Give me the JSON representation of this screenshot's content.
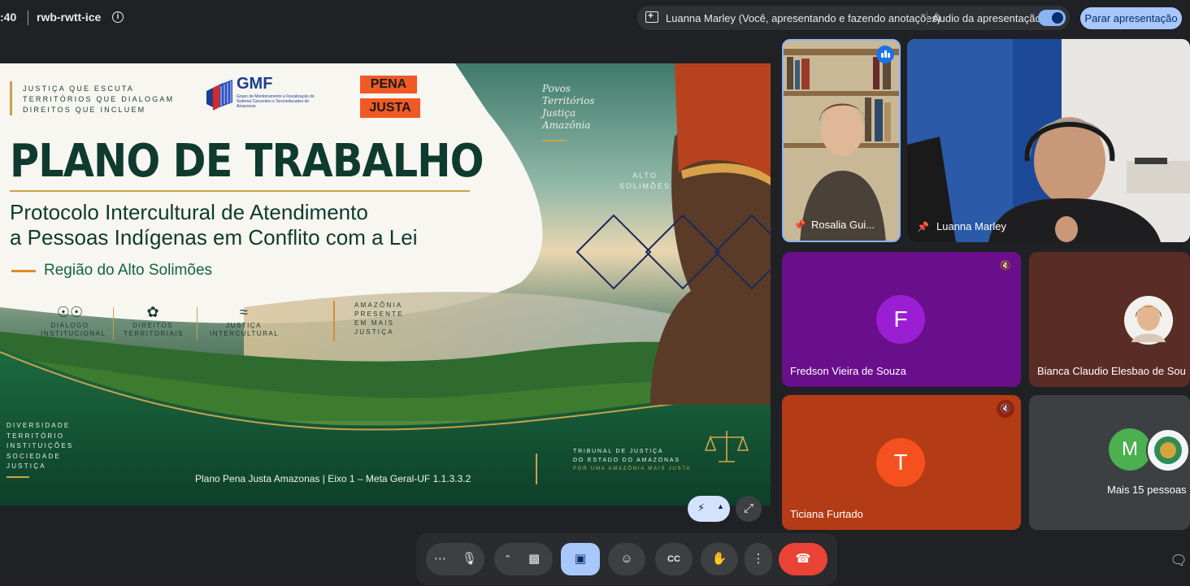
{
  "topbar": {
    "time": ":40",
    "meeting_code": "rwb-rwtt-ice",
    "presenter_text": "Luanna Marley (Você, apresentando e fazendo anotações)",
    "audio_label": "Áudio da apresentação",
    "stop_button": "Parar apresentação"
  },
  "slide": {
    "tagline": [
      "JUSTIÇA QUE ESCUTA",
      "TERRITÓRIOS QUE DIALOGAM",
      "DIREITOS QUE INCLUEM"
    ],
    "gmf": "GMF",
    "gmf_sub": "Grupo de Monitoramento e Fiscalização do Sistema Carcerário e Socioeducativo do Amazonas",
    "pena": "PENA",
    "justa": "JUSTA",
    "title": "PLANO DE TRABALHO",
    "subtitle_line1": "Protocolo Intercultural de Atendimento",
    "subtitle_line2": "a Pessoas Indígenas em Conflito com a Lei",
    "region": "Região do Alto Solimões",
    "pillars": [
      {
        "line1": "DIÁLOGO",
        "line2": "INSTITUCIONAL"
      },
      {
        "line1": "DIREITOS",
        "line2": "TERRITORIAIS"
      },
      {
        "line1": "JUSTIÇA",
        "line2": "INTERCULTURAL"
      }
    ],
    "amazonia": [
      "AMAZÔNIA",
      "PRESENTE",
      "EM MAIS",
      "JUSTIÇA"
    ],
    "diversity": [
      "DIVERSIDADE",
      "TERRITÓRIO",
      "INSTITUIÇÕES",
      "SOCIEDADE",
      "JUSTIÇA"
    ],
    "footer": "Plano Pena Justa Amazonas  |  Eixo 1 – Meta Geral-UF 1.1.3.3.2",
    "tribunal": [
      "TRIBUNAL DE JUSTIÇA",
      "DO ESTADO DO AMAZONAS"
    ],
    "tribunal_motto": "POR UMA AMAZÔNIA MAIS JUSTA",
    "povos": [
      "Povos",
      "Territórios",
      "Justiça",
      "Amazônia"
    ],
    "alto": [
      "ALTO",
      "SOLIMÕES"
    ]
  },
  "participants": [
    {
      "name": "Rosalia Gui...",
      "pinned": true
    },
    {
      "name": "Luanna Marley",
      "pinned": true
    },
    {
      "name": "Fredson Vieira de Souza",
      "initial": "F",
      "muted": true
    },
    {
      "name": "Bianca Claudio Elesbao de Sou",
      "muted": false
    },
    {
      "name": "Ticiana Furtado",
      "initial": "T",
      "muted": true
    },
    {
      "name": "Mais 15 pessoas",
      "initial": "M"
    }
  ],
  "colors": {
    "accent_blue": "#a8c7fa",
    "end_call_red": "#ea4335",
    "tile_purple": "#6a0f8c",
    "tile_orange": "#b33b16"
  }
}
